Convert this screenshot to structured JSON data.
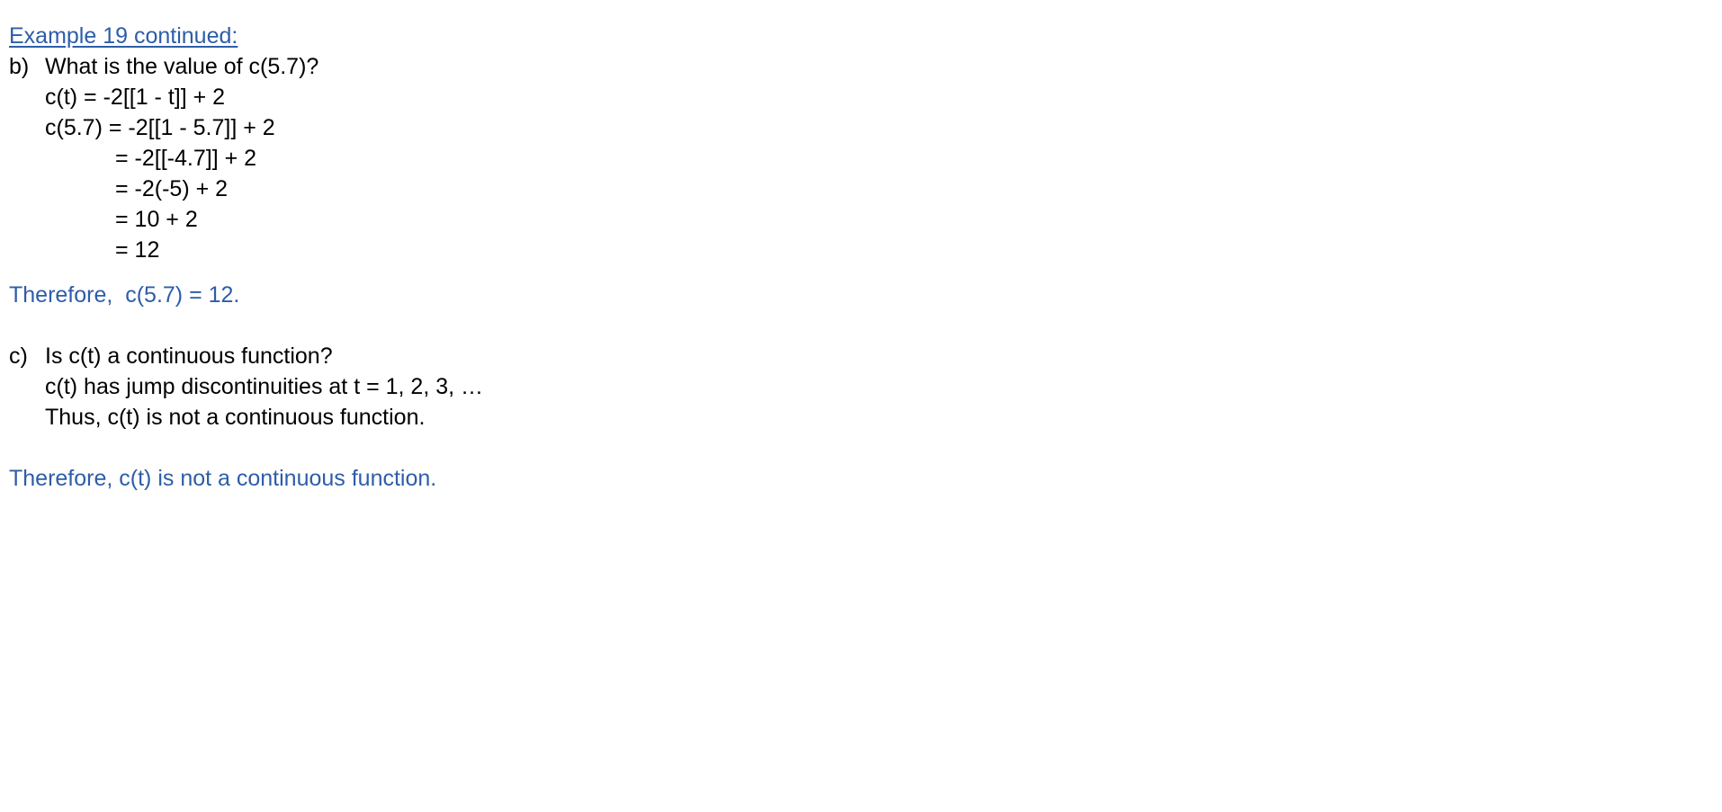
{
  "colors": {
    "text": "#000000",
    "accent_blue": "#2E5DA8",
    "background": "#ffffff"
  },
  "title": "Example 19 continued:",
  "part_b": {
    "marker": "b)",
    "question": "What is the value of c(5.7)?",
    "steps": [
      "c(t) = -2[[1 - t]] + 2",
      "c(5.7) = -2[[1 - 5.7]] + 2",
      "= -2[[-4.7]] + 2",
      "= -2(-5) + 2",
      "= 10 + 2",
      "= 12"
    ],
    "conclusion": "Therefore,  c(5.7) = 12."
  },
  "part_c": {
    "marker": "c)",
    "question": "Is c(t) a continuous function?",
    "steps": [
      "c(t) has jump discontinuities at t = 1, 2, 3, …",
      "Thus, c(t) is not a continuous function."
    ],
    "conclusion": "Therefore, c(t) is not a continuous function."
  }
}
